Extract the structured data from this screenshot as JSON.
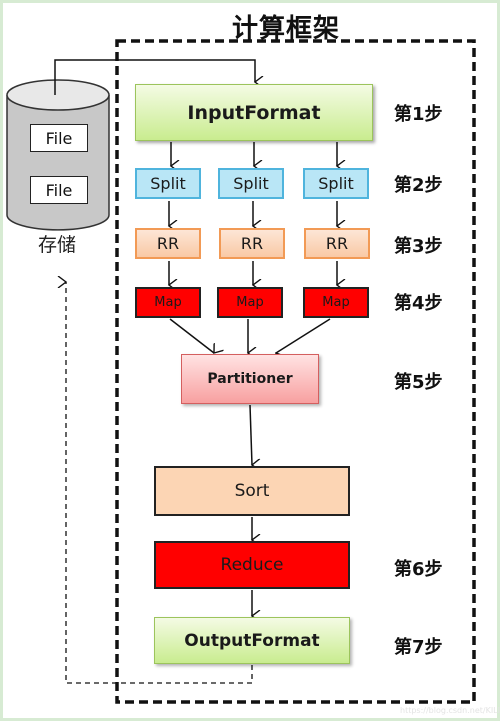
{
  "title": "计算框架",
  "storage": {
    "label": "存储",
    "files": [
      "File",
      "File"
    ]
  },
  "nodes": {
    "input_format": "InputFormat",
    "splits": [
      "Split",
      "Split",
      "Split"
    ],
    "record_readers": [
      "RR",
      "RR",
      "RR"
    ],
    "maps": [
      "Map",
      "Map",
      "Map"
    ],
    "partitioner": "Partitioner",
    "sort": "Sort",
    "reduce": "Reduce",
    "output_format": "OutputFormat"
  },
  "steps": [
    "第1步",
    "第2步",
    "第3步",
    "第4步",
    "第5步",
    "第6步",
    "第7步"
  ],
  "colors": {
    "input_output_fill": "#c9ec8f",
    "split_fill": "#b9e6f6",
    "rr_fill": "#f9c9a5",
    "map_reduce_fill": "#ff0000",
    "partitioner_fill": "#f8a0a0",
    "sort_fill": "#fcd5b4",
    "page_border": "#d7ebd3"
  },
  "watermark": "https://blog.csdn.net/KILITOH"
}
